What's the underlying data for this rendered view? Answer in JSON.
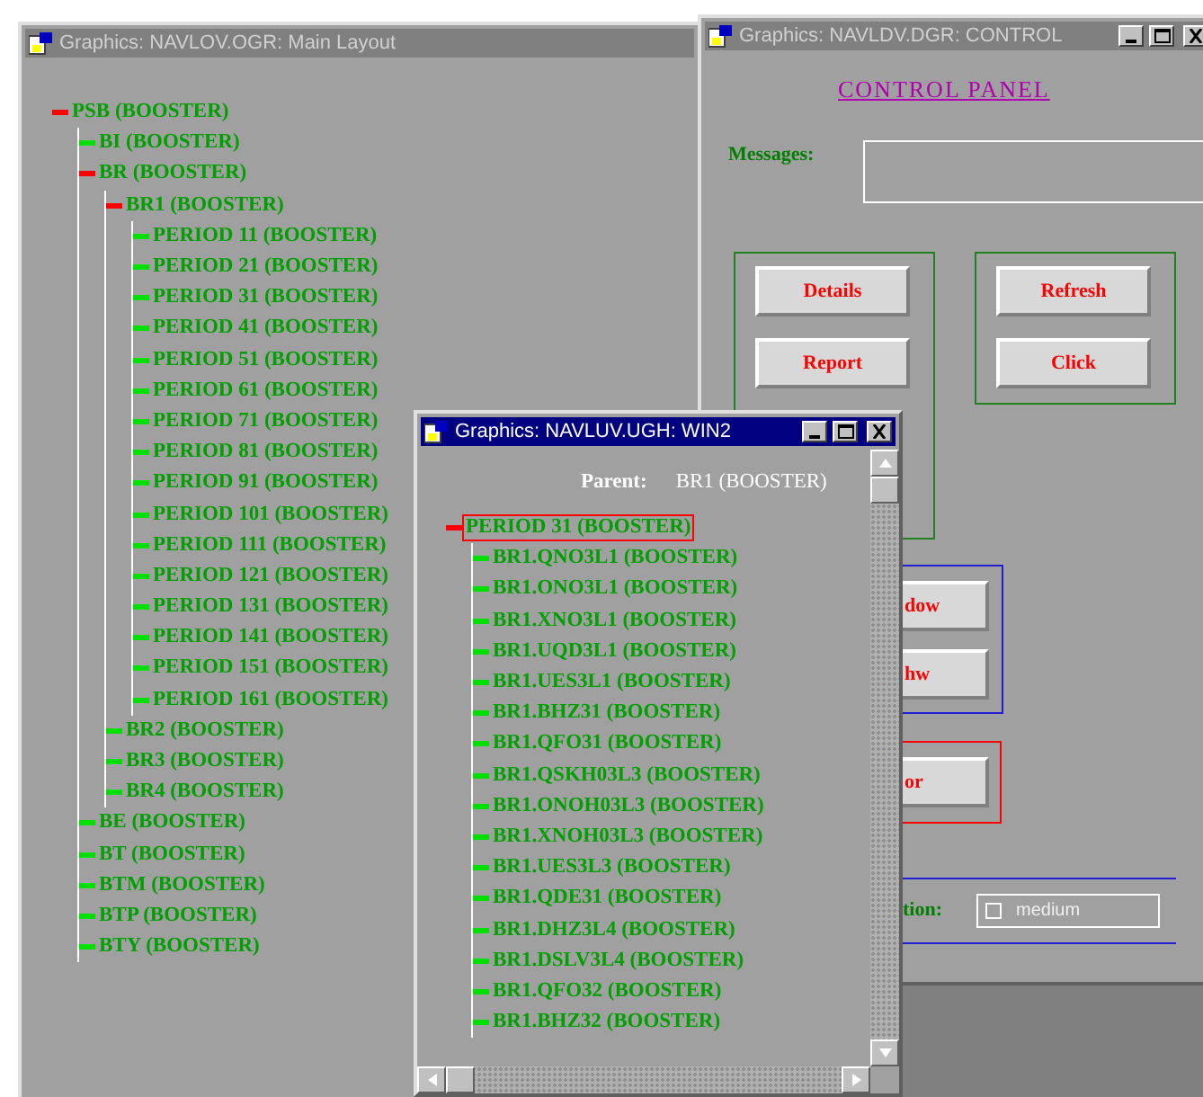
{
  "main_window": {
    "title": "Graphics: NAVLOV.OGR: Main Layout",
    "active": false,
    "tree": [
      {
        "label": "PSB (BOOSTER)",
        "expanded": true,
        "children": [
          {
            "label": "BI (BOOSTER)",
            "expanded": false
          },
          {
            "label": "BR (BOOSTER)",
            "expanded": true,
            "children": [
              {
                "label": "BR1 (BOOSTER)",
                "expanded": true,
                "children": [
                  {
                    "label": "PERIOD 11 (BOOSTER)",
                    "expanded": false
                  },
                  {
                    "label": "PERIOD 21 (BOOSTER)",
                    "expanded": false
                  },
                  {
                    "label": "PERIOD 31 (BOOSTER)",
                    "expanded": false
                  },
                  {
                    "label": "PERIOD 41 (BOOSTER)",
                    "expanded": false
                  },
                  {
                    "label": "PERIOD 51 (BOOSTER)",
                    "expanded": false
                  },
                  {
                    "label": "PERIOD 61 (BOOSTER)",
                    "expanded": false
                  },
                  {
                    "label": "PERIOD 71 (BOOSTER)",
                    "expanded": false
                  },
                  {
                    "label": "PERIOD 81 (BOOSTER)",
                    "expanded": false
                  },
                  {
                    "label": "PERIOD 91 (BOOSTER)",
                    "expanded": false
                  },
                  {
                    "label": "PERIOD 101 (BOOSTER)",
                    "expanded": false
                  },
                  {
                    "label": "PERIOD 111 (BOOSTER)",
                    "expanded": false
                  },
                  {
                    "label": "PERIOD 121 (BOOSTER)",
                    "expanded": false
                  },
                  {
                    "label": "PERIOD 131 (BOOSTER)",
                    "expanded": false
                  },
                  {
                    "label": "PERIOD 141 (BOOSTER)",
                    "expanded": false
                  },
                  {
                    "label": "PERIOD 151 (BOOSTER)",
                    "expanded": false
                  },
                  {
                    "label": "PERIOD 161 (BOOSTER)",
                    "expanded": false
                  }
                ]
              },
              {
                "label": "BR2 (BOOSTER)",
                "expanded": false
              },
              {
                "label": "BR3 (BOOSTER)",
                "expanded": false
              },
              {
                "label": "BR4 (BOOSTER)",
                "expanded": false
              }
            ]
          },
          {
            "label": "BE (BOOSTER)",
            "expanded": false
          },
          {
            "label": "BT (BOOSTER)",
            "expanded": false
          },
          {
            "label": "BTM (BOOSTER)",
            "expanded": false
          },
          {
            "label": "BTP (BOOSTER)",
            "expanded": false
          },
          {
            "label": "BTY (BOOSTER)",
            "expanded": false
          }
        ]
      }
    ]
  },
  "control_window": {
    "title": "Graphics: NAVLDV.DGR: CONTROL",
    "active": false,
    "heading": "CONTROL PANEL",
    "messages_label": "Messages:",
    "groups": [
      {
        "color": "#208020",
        "buttons": [
          "Details",
          "Report"
        ]
      },
      {
        "color": "#208020",
        "buttons": [
          "Refresh",
          "Click"
        ]
      },
      {
        "color": "#2020d0",
        "buttons": [
          "dow",
          "hw"
        ]
      },
      {
        "color": "#ff0000",
        "buttons": [
          "or"
        ]
      }
    ],
    "option_label": "tion:",
    "option_field": {
      "checked": false,
      "value": "medium"
    }
  },
  "win2": {
    "title": "Graphics: NAVLUV.UGH: WIN2",
    "active": true,
    "parent_label": "Parent:",
    "parent_value": "BR1 (BOOSTER)",
    "tree": [
      {
        "label": "PERIOD 31 (BOOSTER)",
        "expanded": true,
        "selected": true,
        "children": [
          {
            "label": "BR1.QNO3L1 (BOOSTER)",
            "expanded": false,
            "selected": false
          },
          {
            "label": "BR1.ONO3L1 (BOOSTER)",
            "expanded": false,
            "selected": false
          },
          {
            "label": "BR1.XNO3L1 (BOOSTER)",
            "expanded": false,
            "selected": false
          },
          {
            "label": "BR1.UQD3L1 (BOOSTER)",
            "expanded": false,
            "selected": false
          },
          {
            "label": "BR1.UES3L1 (BOOSTER)",
            "expanded": false,
            "selected": false
          },
          {
            "label": "BR1.BHZ31 (BOOSTER)",
            "expanded": false,
            "selected": false
          },
          {
            "label": "BR1.QFO31 (BOOSTER)",
            "expanded": false,
            "selected": false
          },
          {
            "label": "BR1.QSKH03L3 (BOOSTER)",
            "expanded": false,
            "selected": false
          },
          {
            "label": "BR1.ONOH03L3 (BOOSTER)",
            "expanded": false,
            "selected": false
          },
          {
            "label": "BR1.XNOH03L3 (BOOSTER)",
            "expanded": false,
            "selected": false
          },
          {
            "label": "BR1.UES3L3 (BOOSTER)",
            "expanded": false,
            "selected": false
          },
          {
            "label": "BR1.QDE31 (BOOSTER)",
            "expanded": false,
            "selected": false
          },
          {
            "label": "BR1.DHZ3L4 (BOOSTER)",
            "expanded": false,
            "selected": false
          },
          {
            "label": "BR1.DSLV3L4 (BOOSTER)",
            "expanded": false,
            "selected": false
          },
          {
            "label": "BR1.QFO32 (BOOSTER)",
            "expanded": false,
            "selected": false
          },
          {
            "label": "BR1.BHZ32 (BOOSTER)",
            "expanded": false,
            "selected": false
          }
        ]
      }
    ]
  }
}
